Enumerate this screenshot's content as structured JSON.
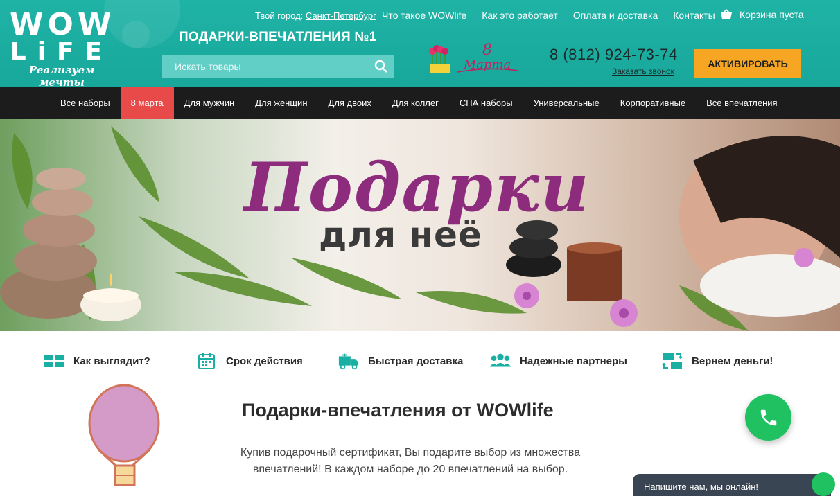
{
  "header": {
    "logo_line1": "WOW",
    "logo_line2": "LiFE",
    "logo_slogan": "Реализуем мечты",
    "city_prefix": "Твой город:",
    "city": "Санкт-Петербург",
    "top_nav": [
      "Что такое WOWlife",
      "Как это работает",
      "Оплата и доставка",
      "Контакты"
    ],
    "cart_label": "Корзина пуста",
    "tagline": "ПОДАРКИ-ВПЕЧАТЛЕНИЯ №1",
    "search_placeholder": "Искать товары",
    "promo_number": "8",
    "promo_word": "Марта",
    "phone": "8 (812) 924-73-74",
    "callback_label": "Заказать звонок",
    "activate_label": "АКТИВИРОВАТЬ"
  },
  "main_nav": {
    "items": [
      "Все наборы",
      "8 марта",
      "Для мужчин",
      "Для женщин",
      "Для двоих",
      "Для коллег",
      "СПА наборы",
      "Универсальные",
      "Корпоративные",
      "Все впечатления"
    ],
    "active_index": 1
  },
  "hero": {
    "title": "Подарки",
    "subtitle": "для неё"
  },
  "features": [
    {
      "label": "Как выглядит?",
      "icon": "gift-card-icon"
    },
    {
      "label": "Срок действия",
      "icon": "calendar-icon"
    },
    {
      "label": "Быстрая доставка",
      "icon": "delivery-truck-icon"
    },
    {
      "label": "Надежные партнеры",
      "icon": "partners-icon"
    },
    {
      "label": "Вернем деньги!",
      "icon": "money-back-icon"
    }
  ],
  "content": {
    "title": "Подарки-впечатления от WOWlife",
    "text": "Купив подарочный сертификат, Вы подарите выбор из множества впечатлений! В каждом наборе до 20 впечатлений на выбор."
  },
  "chat": {
    "label": "Напишите нам, мы онлайн!"
  },
  "colors": {
    "header_teal": "#1fb3a6",
    "nav_dark": "#1c1c1c",
    "nav_active": "#e84a4a",
    "activate_button": "#f6a623",
    "hero_title": "#8d2c7d",
    "call_button": "#1fc160",
    "chat_bar": "#3a4554"
  }
}
